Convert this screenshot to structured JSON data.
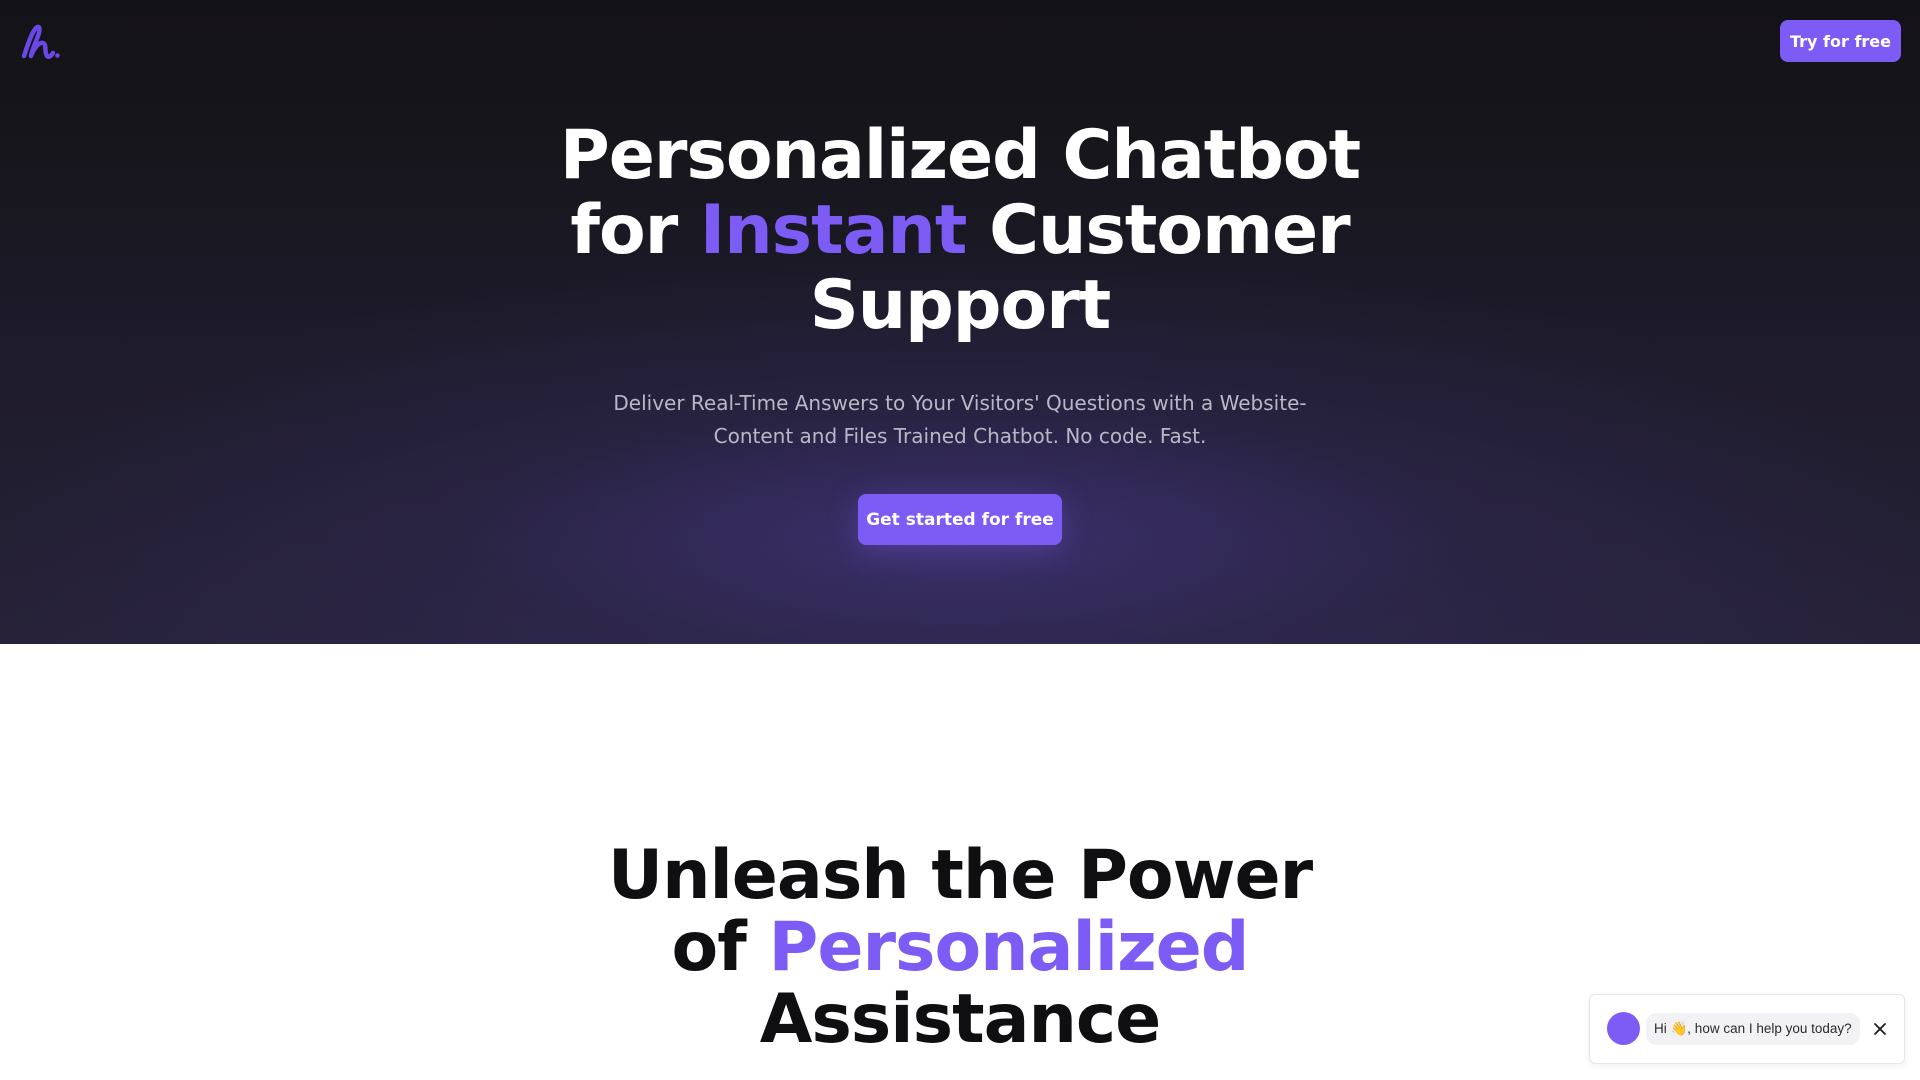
{
  "header": {
    "logo_icon": "brand-logo-icon",
    "cta_label": "Try for free"
  },
  "hero": {
    "title_line1": "Personalized Chatbot",
    "title_line2_prefix": "for ",
    "title_line2_accent": "Instant",
    "title_line2_suffix": " Customer",
    "title_line3": "Support",
    "subtitle_line1": "Deliver Real-Time Answers to Your Visitors' Questions with a Website-",
    "subtitle_line2": "Content and Files Trained Chatbot. No code. Fast.",
    "cta_label": "Get started for free"
  },
  "section": {
    "title_line1": "Unleash the Power",
    "title_line2_prefix": "of ",
    "title_line2_accent": "Personalized",
    "title_line3": "Assistance"
  },
  "chat_widget": {
    "message": "Hi 👋, how can I help you today?",
    "close_icon": "close-icon"
  },
  "colors": {
    "accent": "#7c5cf5",
    "hero_bg_top": "#131217",
    "hero_bg_bottom": "#272239",
    "subtitle_text": "#b9b7c6"
  }
}
